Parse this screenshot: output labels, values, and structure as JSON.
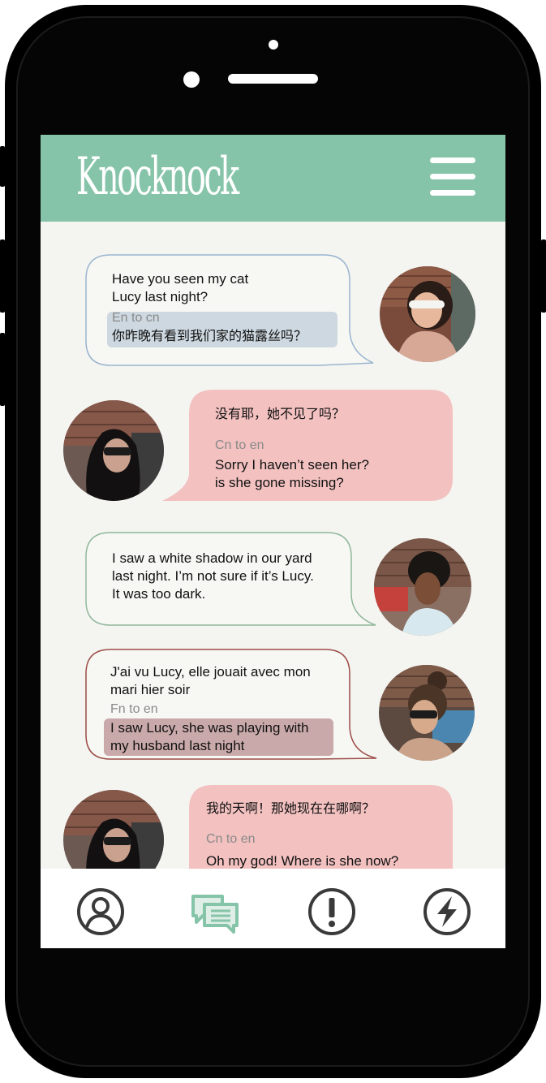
{
  "app": {
    "title": "Knocknock"
  },
  "header": {
    "menu_icon": "hamburger-menu-icon"
  },
  "colors": {
    "header": "#86c4a9",
    "incoming_bubble": "#f2c1c0",
    "blue_highlight": "#cdd8e0",
    "red_highlight": "#c9a9a9",
    "icon_dark": "#3a3a3a",
    "icon_accent": "#86c4a9"
  },
  "messages": [
    {
      "original": [
        "Have you seen my cat",
        "Lucy last night?"
      ],
      "translation_label": "En to cn",
      "translation": [
        "你昨晚有看到我们家的猫露丝吗？"
      ],
      "side": "right",
      "border": "#9ab5cf"
    },
    {
      "original": [
        "没有耶，她不见了吗？"
      ],
      "translation_label": "Cn to en",
      "translation": [
        "Sorry I haven’t seen her?",
        "is she gone missing?"
      ],
      "side": "left"
    },
    {
      "original": [
        "I saw a white shadow in our yard",
        "last night. I’m not sure if it’s Lucy.",
        "It was too dark."
      ],
      "side": "right",
      "border": "#8fb89a"
    },
    {
      "original": [
        "J'ai vu Lucy, elle jouait avec mon",
        "mari hier soir"
      ],
      "translation_label": "Fn to en",
      "translation": [
        "I saw Lucy, she was playing with",
        "my husband last night"
      ],
      "side": "right",
      "border": "#9c4d47"
    },
    {
      "original": [
        "我的天啊！那她现在在哪啊？"
      ],
      "translation_label": "Cn to en",
      "translation": [
        "Oh my god! Where is she now?"
      ],
      "side": "left"
    }
  ],
  "tabs": [
    {
      "icon": "profile-icon"
    },
    {
      "icon": "chat-icon",
      "active": true
    },
    {
      "icon": "alert-icon"
    },
    {
      "icon": "lightning-icon"
    }
  ]
}
